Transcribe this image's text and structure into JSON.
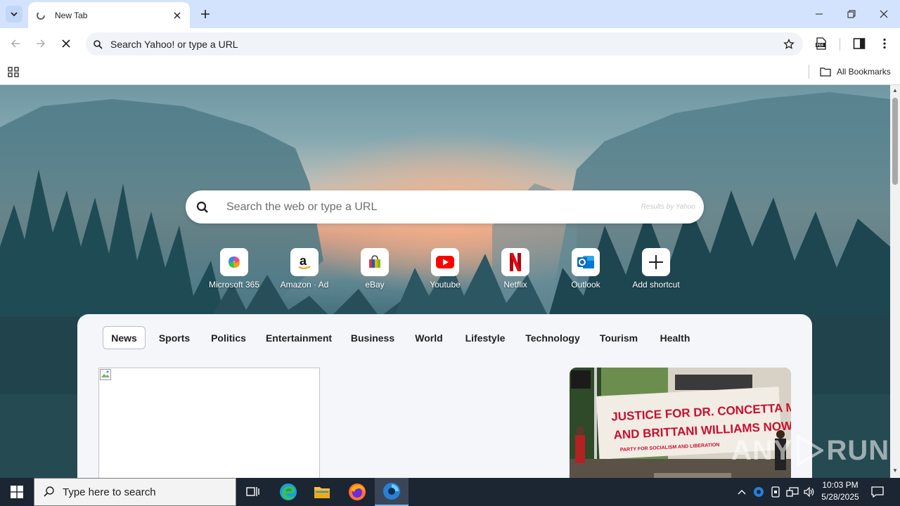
{
  "browser": {
    "tab": {
      "title": "New Tab"
    },
    "omnibox": {
      "text": "Search Yahoo! or type a URL"
    },
    "bookmarks_bar": {
      "all_bookmarks_label": "All Bookmarks"
    }
  },
  "page": {
    "search": {
      "placeholder": "Search the web or type a URL",
      "powered_by": "Results by Yahoo"
    },
    "shortcuts": [
      {
        "label": "Microsoft 365",
        "icon": "microsoft-365-icon"
      },
      {
        "label": "Amazon · Ad",
        "icon": "amazon-icon"
      },
      {
        "label": "eBay",
        "icon": "ebay-icon"
      },
      {
        "label": "Youtube",
        "icon": "youtube-icon"
      },
      {
        "label": "Netflix",
        "icon": "netflix-icon"
      },
      {
        "label": "Outlook",
        "icon": "outlook-icon"
      },
      {
        "label": "Add shortcut",
        "icon": "plus-icon"
      }
    ],
    "news": {
      "tabs": [
        "News",
        "Sports",
        "Politics",
        "Entertainment",
        "Business",
        "World",
        "Lifestyle",
        "Technology",
        "Tourism",
        "Health"
      ],
      "active_tab": "News",
      "photo_banner": {
        "line1": "JUSTICE FOR DR. CONCETTA MANNER",
        "line2": "AND BRITTANI WILLIAMS NOW!",
        "line3": "PARTY FOR SOCIALISM AND LIBERATION"
      }
    },
    "watermark": {
      "left": "ANY",
      "right": "RUN"
    }
  },
  "taskbar": {
    "search_placeholder": "Type here to search",
    "clock": {
      "time": "10:03 PM",
      "date": "5/28/2025"
    }
  },
  "colors": {
    "tabstrip": "#d3e3fd",
    "taskbar": "#1c2532",
    "youtube": "#ff0000",
    "netflix": "#e50914",
    "outlook": "#0f6cbd"
  }
}
